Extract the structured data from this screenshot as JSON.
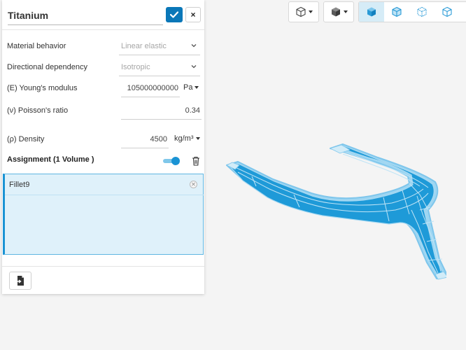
{
  "panel": {
    "title_value": "Titanium",
    "confirm_label": "✔",
    "cancel_label": "×",
    "fields": {
      "material_behavior": {
        "label": "Material behavior",
        "value": "Linear elastic"
      },
      "directional_dependency": {
        "label": "Directional dependency",
        "value": "Isotropic"
      },
      "youngs_modulus": {
        "label": "(E) Young's modulus",
        "value": "105000000000",
        "unit": "Pa"
      },
      "poissons_ratio": {
        "label": "(ν) Poisson's ratio",
        "value": "0.34"
      },
      "density": {
        "label": "(ρ) Density",
        "value": "4500",
        "unit": "kg/m³"
      }
    },
    "assignment": {
      "label": "Assignment (1 Volume )",
      "toggle_on": true,
      "items": [
        "Fillet9"
      ]
    }
  },
  "toolbar": {
    "view_buttons": [
      "cube-solid-icon",
      "cube-front-icon",
      "cube-wire-icon",
      "cube-outline-icon"
    ],
    "active_view": 0
  },
  "colors": {
    "primary": "#0a77b8",
    "accent": "#1a93d4",
    "selection_fill": "#dff1fa",
    "model_fill": "#1e9ad8",
    "model_edge": "#a7d9f2"
  }
}
